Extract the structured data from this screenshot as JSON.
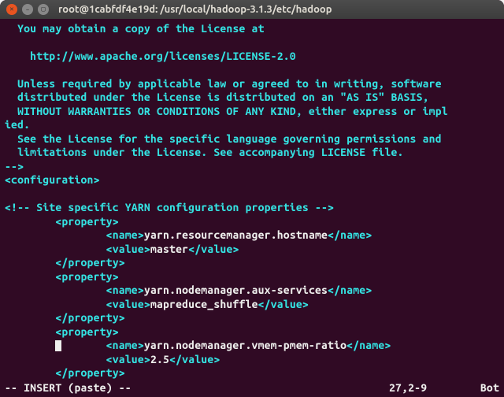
{
  "titlebar": {
    "title": "root@1cabfdf4e19d: /usr/local/hadoop-3.1.3/etc/hadoop"
  },
  "license": {
    "obtain": "  You may obtain a copy of the License at",
    "url": "    http://www.apache.org/licenses/LICENSE-2.0",
    "unless1": "  Unless required by applicable law or agreed to in writing, software",
    "unless2": "  distributed under the License is distributed on an \"AS IS\" BASIS,",
    "unless3": "  WITHOUT WARRANTIES OR CONDITIONS OF ANY KIND, either express or impl",
    "unless4": "ied.",
    "see1": "  See the License for the specific language governing permissions and",
    "see2": "  limitations under the License. See accompanying LICENSE file.",
    "close": "-->"
  },
  "xml": {
    "config_open": "configuration",
    "config_close": "configuration",
    "comment": "!-- Site specific YARN configuration properties --",
    "property": "property",
    "name_tag": "name",
    "value_tag": "value",
    "props": [
      {
        "name": "yarn.resourcemanager.hostname",
        "value": "master"
      },
      {
        "name": "yarn.nodemanager.aux-services",
        "value": "mapreduce_shuffle"
      },
      {
        "name": "yarn.nodemanager.vmem-pmem-ratio",
        "value": "2.5"
      }
    ]
  },
  "status": {
    "mode": "-- INSERT (paste) --",
    "position": "27,2-9",
    "location": "Bot"
  }
}
